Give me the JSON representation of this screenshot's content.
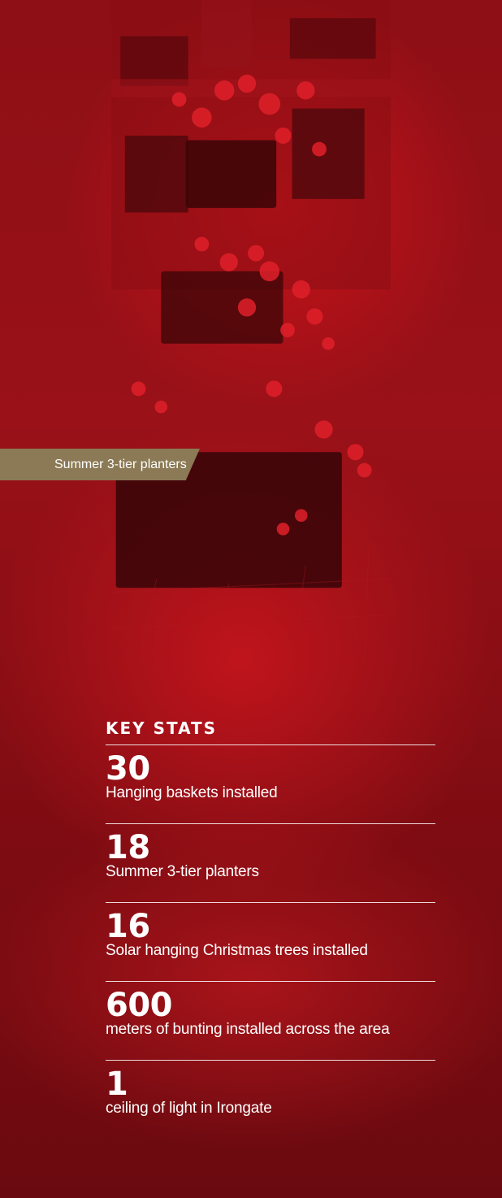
{
  "photo": {
    "subject": "three-tier planter of red petunias in front of a building"
  },
  "caption": {
    "text": "Summer 3-tier planters"
  },
  "key_stats": {
    "heading": "KEY STATS",
    "items": [
      {
        "value": "30",
        "label": "Hanging baskets installed"
      },
      {
        "value": "18",
        "label": "Summer 3-tier planters"
      },
      {
        "value": "16",
        "label": "Solar hanging Christmas trees installed"
      },
      {
        "value": "600",
        "label": "meters of bunting installed across the area"
      },
      {
        "value": "1",
        "label": "ceiling of light in Irongate"
      }
    ]
  },
  "colors": {
    "tint": "#9a1118",
    "caption_bg": "#8b7a55",
    "text": "#ffffff"
  }
}
